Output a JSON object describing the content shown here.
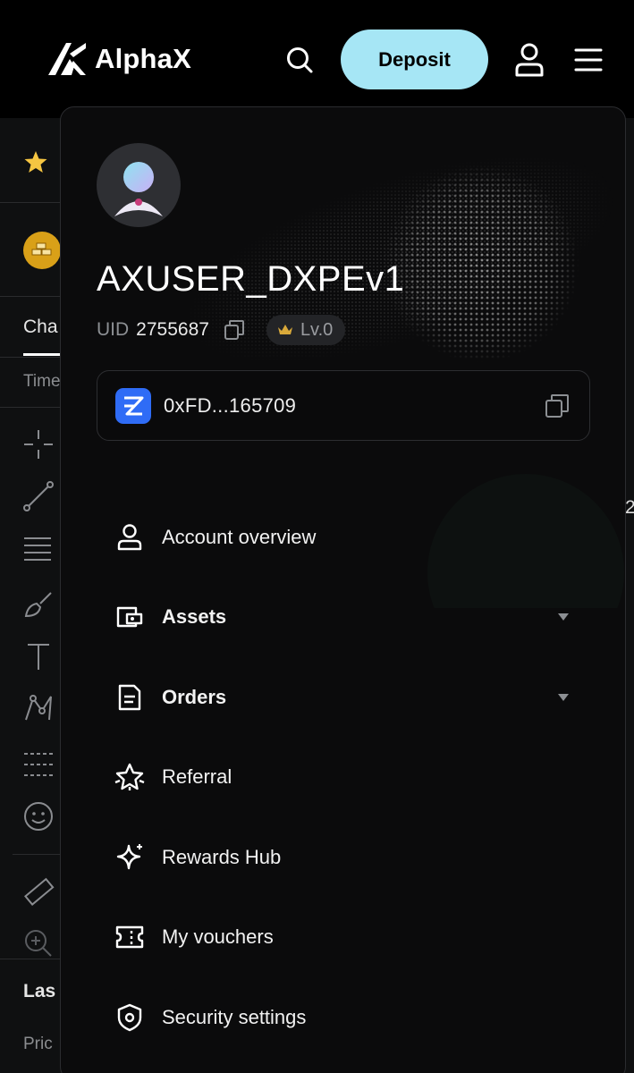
{
  "header": {
    "logo_text": "AlphaX",
    "deposit_label": "Deposit"
  },
  "background": {
    "tab_label": "Cha",
    "time_label": "Time",
    "last_label": "Las",
    "price_label": "Pric",
    "right_digit": "2"
  },
  "drawer": {
    "username": "AXUSER_DXPEv1",
    "uid_label": "UID",
    "uid_value": "2755687",
    "level": "Lv.0",
    "wallet_address": "0xFD...165709",
    "menu": [
      {
        "label": "Account overview",
        "icon": "user-icon",
        "bold": false,
        "expandable": false
      },
      {
        "label": "Assets",
        "icon": "wallet-icon",
        "bold": true,
        "expandable": true
      },
      {
        "label": "Orders",
        "icon": "document-icon",
        "bold": true,
        "expandable": true
      },
      {
        "label": "Referral",
        "icon": "referral-star-icon",
        "bold": false,
        "expandable": false
      },
      {
        "label": "Rewards Hub",
        "icon": "sparkle-icon",
        "bold": false,
        "expandable": false
      },
      {
        "label": "My vouchers",
        "icon": "ticket-icon",
        "bold": false,
        "expandable": false
      },
      {
        "label": "Security settings",
        "icon": "shield-icon",
        "bold": false,
        "expandable": false
      }
    ]
  },
  "colors": {
    "deposit_bg": "#a6e6f5",
    "wallet_logo": "#2f6cf6",
    "favorite_star": "#f5c542",
    "coin_gold": "#d9a018"
  }
}
